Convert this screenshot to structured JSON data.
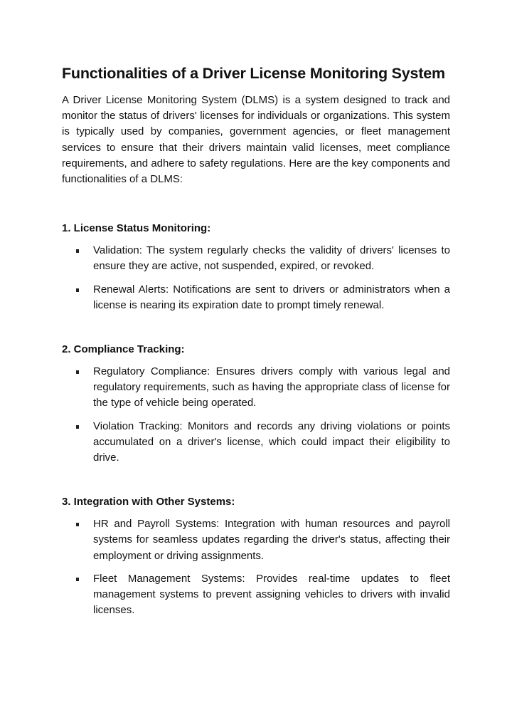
{
  "document": {
    "title": "Functionalities of a Driver License Monitoring System",
    "intro": "A Driver License Monitoring System (DLMS) is a system designed to track and monitor the status of drivers' licenses for individuals or organizations. This system is typically used by companies, government agencies, or fleet management services to ensure that their drivers maintain valid licenses, meet compliance requirements, and adhere to safety regulations. Here are the key components and functionalities of a DLMS:",
    "bullet_icon": "square-bullet",
    "sections": [
      {
        "heading": "1. License Status Monitoring:",
        "items": [
          "Validation: The system regularly checks the validity of drivers' licenses to ensure they are active, not suspended, expired, or revoked.",
          "Renewal Alerts: Notifications are sent to drivers or administrators when a license is nearing its expiration date to prompt timely renewal."
        ]
      },
      {
        "heading": "2. Compliance Tracking:",
        "items": [
          "Regulatory Compliance: Ensures drivers comply with various legal and regulatory requirements, such as having the appropriate class of license for the type of vehicle being operated.",
          "Violation Tracking: Monitors and records any driving violations or points accumulated on a driver's license, which could impact their eligibility to drive."
        ]
      },
      {
        "heading": "3. Integration with Other Systems:",
        "items": [
          "HR and Payroll Systems: Integration with human resources and payroll systems for seamless updates regarding the driver's status, affecting their employment or driving assignments.",
          "Fleet Management Systems: Provides real-time updates to fleet management systems to prevent assigning vehicles to drivers with invalid licenses."
        ]
      }
    ]
  }
}
